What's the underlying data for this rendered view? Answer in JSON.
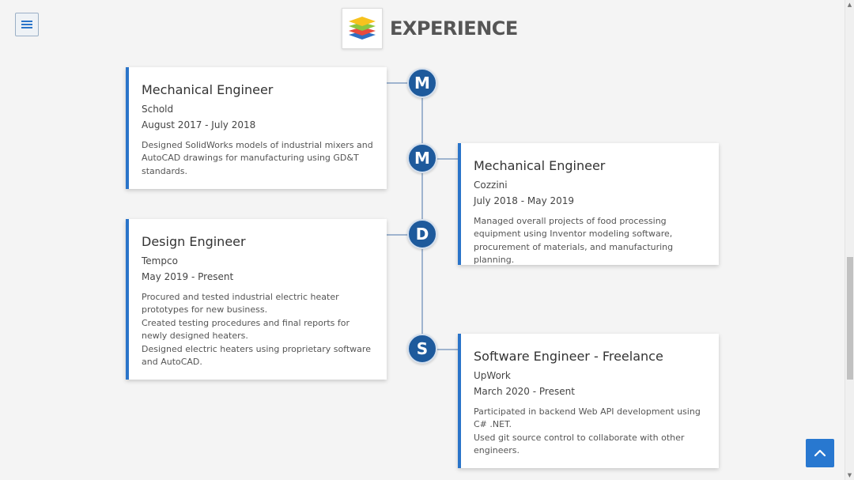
{
  "header": {
    "title": "EXPERIENCE",
    "logo_icon": "layers-stack-icon"
  },
  "menu_button": {
    "icon": "hamburger-menu-icon"
  },
  "back_to_top": {
    "icon": "chevron-up-icon"
  },
  "colors": {
    "accent": "#2a74c9",
    "node": "#1e5a9c",
    "line": "#9fb4cf",
    "background": "#f4f4f4"
  },
  "timeline": [
    {
      "initial": "M",
      "title": "Mechanical Engineer",
      "company": "Schold",
      "dates": "August 2017 - July 2018",
      "description": [
        "Designed SolidWorks models of industrial mixers and AutoCAD drawings for manufacturing using GD&T standards."
      ]
    },
    {
      "initial": "M",
      "title": "Mechanical Engineer",
      "company": "Cozzini",
      "dates": "July 2018 - May 2019",
      "description": [
        "Managed overall projects of food processing equipment using Inventor modeling software, procurement of materials, and manufacturing planning."
      ]
    },
    {
      "initial": "D",
      "title": "Design Engineer",
      "company": "Tempco",
      "dates": "May 2019 - Present",
      "description": [
        "Procured and tested industrial electric heater prototypes for new business.",
        "Created testing procedures and final reports for newly designed heaters.",
        "Designed electric heaters using proprietary software and AutoCAD."
      ]
    },
    {
      "initial": "S",
      "title": "Software Engineer - Freelance",
      "company": "UpWork",
      "dates": "March 2020 - Present",
      "description": [
        "Participated in backend Web API development using C# .NET.",
        "Used git source control to collaborate with other engineers."
      ]
    }
  ]
}
